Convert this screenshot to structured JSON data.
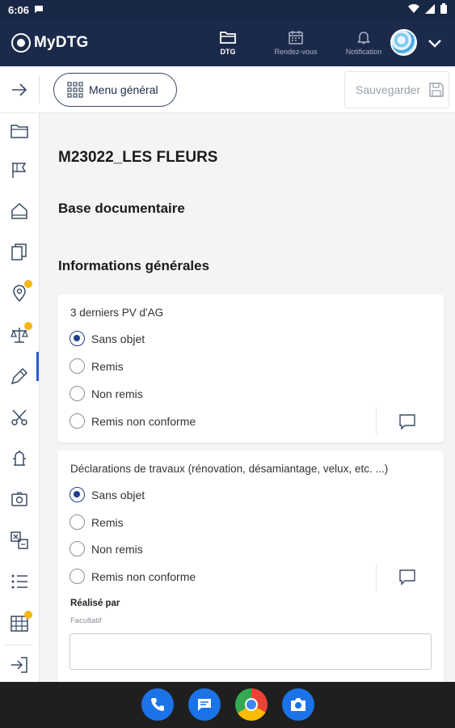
{
  "status_bar": {
    "time": "6:06"
  },
  "app_bar": {
    "brand": "MyDTG",
    "nav": [
      {
        "label": "DTG",
        "icon": "folder-icon",
        "active": true
      },
      {
        "label": "Rendez-vous",
        "icon": "calendar-icon",
        "active": false
      },
      {
        "label": "Notification",
        "icon": "bell-icon",
        "active": false
      }
    ]
  },
  "toolbar": {
    "menu_label": "Menu général",
    "save_label": "Sauvegarder"
  },
  "sidebar": {
    "items": [
      {
        "icon": "folder-icon",
        "badge": false
      },
      {
        "icon": "flag-icon",
        "badge": false
      },
      {
        "icon": "house-icon",
        "badge": false
      },
      {
        "icon": "documents-icon",
        "badge": false,
        "active": true
      },
      {
        "icon": "location-pin-icon",
        "badge": true
      },
      {
        "icon": "scales-icon",
        "badge": true
      },
      {
        "icon": "tag-edit-icon",
        "badge": false
      },
      {
        "icon": "scissors-icon",
        "badge": false
      },
      {
        "icon": "fire-hydrant-icon",
        "badge": false
      },
      {
        "icon": "camera-icon",
        "badge": false
      },
      {
        "icon": "compare-icon",
        "badge": false
      },
      {
        "icon": "checklist-icon",
        "badge": false
      },
      {
        "icon": "table-icon",
        "badge": true
      },
      {
        "icon": "logout-icon",
        "badge": false
      }
    ]
  },
  "main": {
    "title": "M23022_LES FLEURS",
    "section": "Base documentaire",
    "subsection": "Informations générales",
    "cards": [
      {
        "question": "3 derniers PV d'AG",
        "options": [
          "Sans objet",
          "Remis",
          "Non remis",
          "Remis non conforme"
        ],
        "selected": 0
      },
      {
        "question": "Déclarations de travaux (rénovation, désamiantage, velux, etc. ...)",
        "options": [
          "Sans objet",
          "Remis",
          "Non remis",
          "Remis non conforme"
        ],
        "selected": 0,
        "field": {
          "label": "Réalisé par",
          "hint": "Facultatif",
          "value": ""
        }
      }
    ]
  },
  "colors": {
    "header": "#1b2a4a",
    "accent": "#1e3f8c",
    "badge": "#f5b418",
    "background": "#f3f4f6"
  }
}
